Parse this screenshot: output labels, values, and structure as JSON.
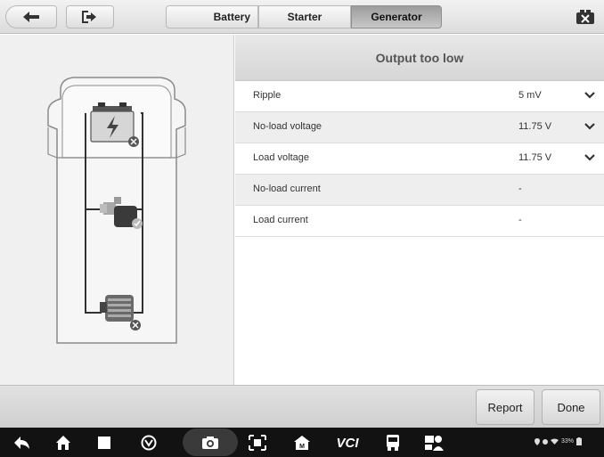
{
  "toolbar": {
    "back_icon": "back-arrow-icon",
    "exit_icon": "exit-icon",
    "tabs": [
      {
        "label": "Battery",
        "active": false
      },
      {
        "label": "Starter",
        "active": false
      },
      {
        "label": "Generator",
        "active": true
      }
    ],
    "corner_icon": "vci-close-icon"
  },
  "diagram": {
    "components": [
      {
        "name": "battery",
        "status": "fail"
      },
      {
        "name": "starter",
        "status": "pass"
      },
      {
        "name": "generator",
        "status": "fail"
      }
    ]
  },
  "result": {
    "status": "Output too low",
    "rows": [
      {
        "label": "Ripple",
        "value": "5 mV",
        "expandable": true
      },
      {
        "label": "No-load voltage",
        "value": "11.75 V",
        "expandable": true
      },
      {
        "label": "Load voltage",
        "value": "11.75 V",
        "expandable": true
      },
      {
        "label": "No-load current",
        "value": "-",
        "expandable": false
      },
      {
        "label": "Load current",
        "value": "-",
        "expandable": false
      }
    ]
  },
  "actions": {
    "report_label": "Report",
    "done_label": "Done"
  },
  "system_bar": {
    "icons": [
      "back-icon",
      "home-icon",
      "recent-apps-icon",
      "browser-icon",
      "camera-icon",
      "screenshot-icon",
      "maxifix-icon",
      "vci-icon",
      "truck-icon",
      "remote-expert-icon"
    ],
    "vci_label": "VCI",
    "battery_text": "33%"
  },
  "colors": {
    "active_tab": "#b0b0b0",
    "fail_badge": "#555555",
    "pass_badge": "#bbbbbb"
  }
}
